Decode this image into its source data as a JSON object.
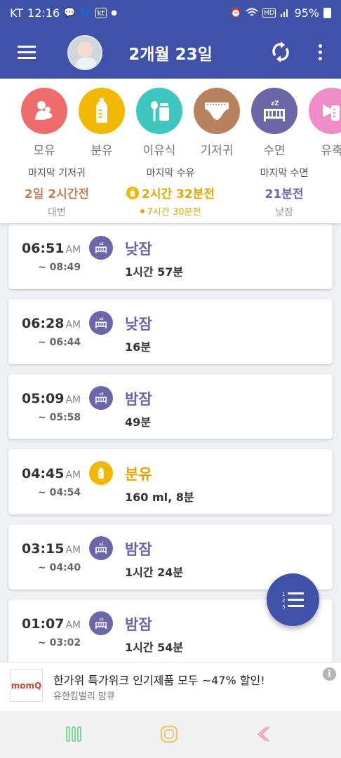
{
  "status_bar": {
    "carrier": "KT",
    "time": "12:16",
    "carrier_badge": "kt",
    "battery": "95%",
    "network": "HD"
  },
  "app_bar": {
    "title": "2개월 23일"
  },
  "categories": [
    {
      "label": "모유",
      "color": "#ef6c6c",
      "icon": "breastfeeding-icon"
    },
    {
      "label": "분유",
      "color": "#f2b700",
      "icon": "bottle-icon"
    },
    {
      "label": "이유식",
      "color": "#3ec7c0",
      "icon": "baby-food-icon"
    },
    {
      "label": "기저귀",
      "color": "#b8825e",
      "icon": "diaper-icon"
    },
    {
      "label": "수면",
      "color": "#6b66a8",
      "icon": "crib-icon"
    },
    {
      "label": "유축",
      "color": "#f08cc8",
      "icon": "breast-pump-icon"
    }
  ],
  "summary": {
    "diaper": {
      "title": "마지막 기저귀",
      "value": "2일 2시간전",
      "sub": "대변",
      "color": "#b8825e"
    },
    "feeding": {
      "title": "마지막 수유",
      "value": "2시간 32분전",
      "sub": "7시간 30분전",
      "color": "#e0a800"
    },
    "sleep": {
      "title": "마지막 수면",
      "value": "21분전",
      "sub": "낮잠",
      "color": "#6b66a8"
    }
  },
  "records": [
    {
      "time": "06:51",
      "ampm": "AM",
      "end": "~ 08:49",
      "type": "낮잠",
      "detail": "1시간 57분",
      "kind": "sleep"
    },
    {
      "time": "06:28",
      "ampm": "AM",
      "end": "~ 06:44",
      "type": "낮잠",
      "detail": "16분",
      "kind": "sleep"
    },
    {
      "time": "05:09",
      "ampm": "AM",
      "end": "~ 05:58",
      "type": "밤잠",
      "detail": "49분",
      "kind": "sleep"
    },
    {
      "time": "04:45",
      "ampm": "AM",
      "end": "~ 04:54",
      "type": "분유",
      "detail": "160 ml, 8분",
      "kind": "formula"
    },
    {
      "time": "03:15",
      "ampm": "AM",
      "end": "~ 04:40",
      "type": "밤잠",
      "detail": "1시간 24분",
      "kind": "sleep"
    },
    {
      "time": "01:07",
      "ampm": "AM",
      "end": "~ 03:02",
      "type": "밤잠",
      "detail": "1시간 54분",
      "kind": "sleep"
    }
  ],
  "colors": {
    "primary": "#3f51a8",
    "sleep": "#6b66a8",
    "formula": "#f2b700",
    "formula_text": "#e0a800"
  },
  "ad": {
    "logo": "momQ",
    "title": "한가위 특가위크 인기제품 모두 ~47% 할인!",
    "sponsor": "유한킴벌리 맘큐",
    "info": "i"
  }
}
